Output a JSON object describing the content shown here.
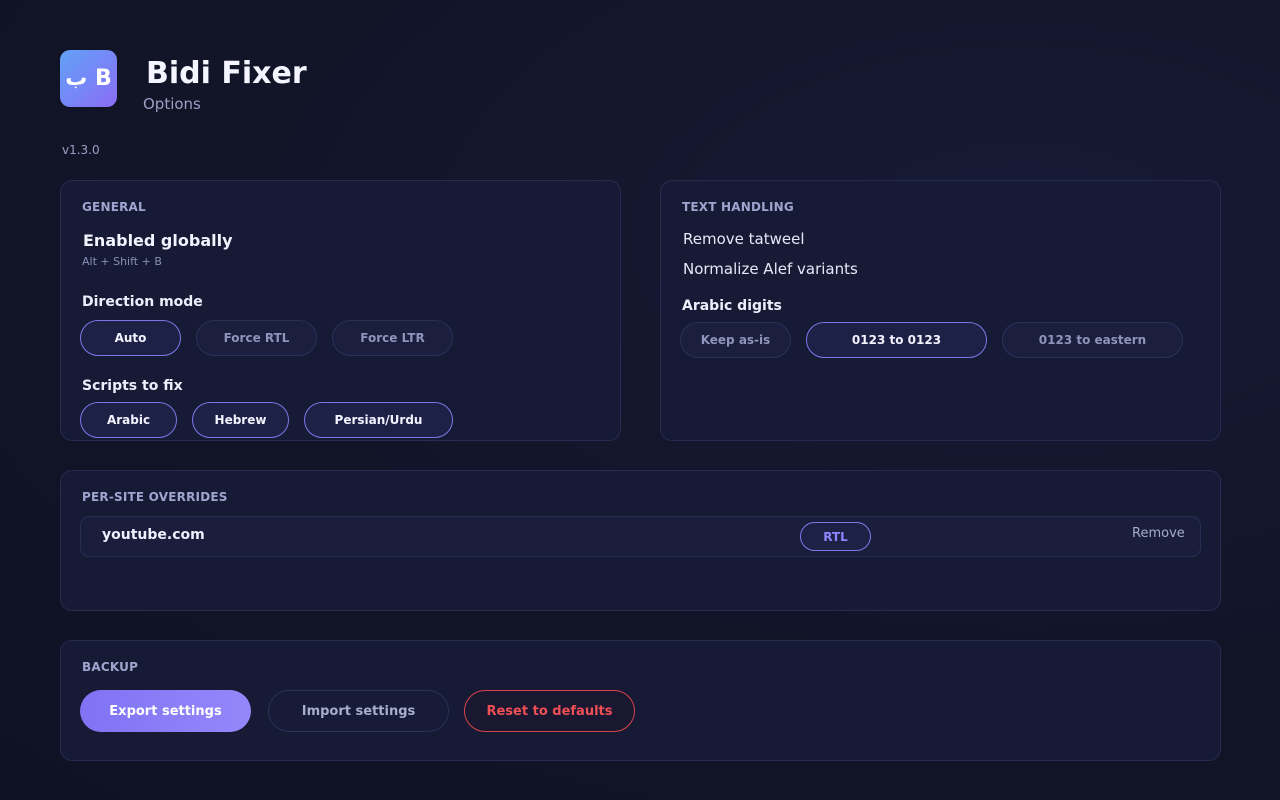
{
  "header": {
    "logo_text": "ب B",
    "title": "Bidi Fixer",
    "subtitle": "Options",
    "version": "v1.3.0"
  },
  "general": {
    "section_title": "GENERAL",
    "enabled_label": "Enabled globally",
    "shortcut": "Alt + Shift + B",
    "direction_label": "Direction mode",
    "direction_options": [
      {
        "label": "Auto",
        "selected": true
      },
      {
        "label": "Force RTL",
        "selected": false
      },
      {
        "label": "Force LTR",
        "selected": false
      }
    ],
    "scripts_label": "Scripts to fix",
    "scripts": [
      {
        "label": "Arabic",
        "selected": true
      },
      {
        "label": "Hebrew",
        "selected": true
      },
      {
        "label": "Persian/Urdu",
        "selected": true
      }
    ]
  },
  "text_handling": {
    "section_title": "TEXT HANDLING",
    "options": [
      "Remove tatweel",
      "Normalize Alef variants"
    ],
    "digits_label": "Arabic digits",
    "digits_options": [
      {
        "label": "Keep as-is",
        "selected": false
      },
      {
        "label": "0123 to 0123",
        "selected": true
      },
      {
        "label": "0123 to eastern",
        "selected": false
      }
    ]
  },
  "overrides": {
    "section_title": "PER-SITE OVERRIDES",
    "rows": [
      {
        "site": "youtube.com",
        "mode": "RTL",
        "remove_label": "Remove"
      }
    ]
  },
  "backup": {
    "section_title": "BACKUP",
    "export_label": "Export settings",
    "import_label": "Import settings",
    "reset_label": "Reset to defaults"
  },
  "colors": {
    "background": "#12152b",
    "card": "#161a35",
    "accent": "#8a7cf8",
    "accent_border": "#7b78e8",
    "danger": "#e5484d",
    "logo_gradient_start": "#62a2f7",
    "logo_gradient_end": "#8a6cf6"
  }
}
